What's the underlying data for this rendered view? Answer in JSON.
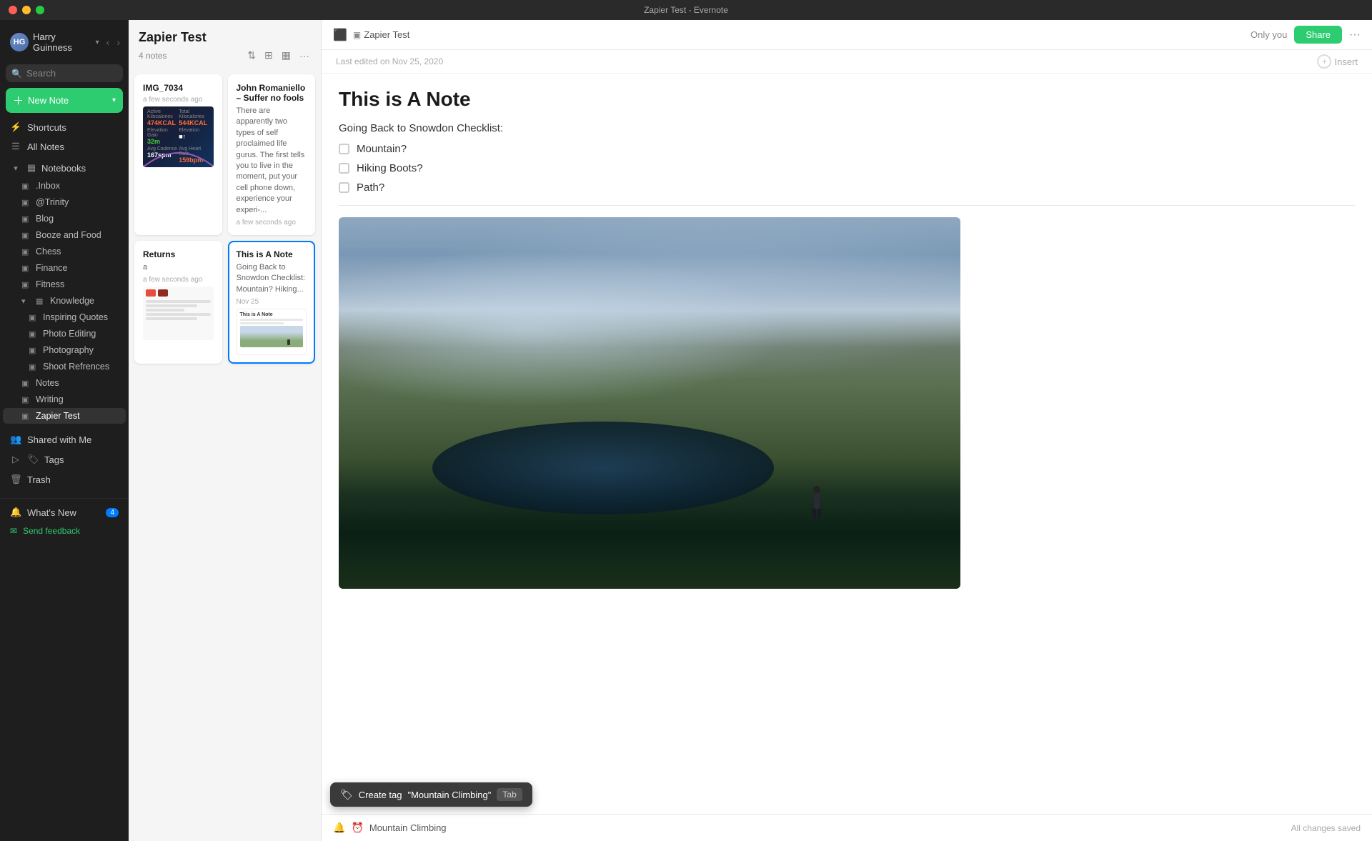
{
  "window": {
    "title": "Zapier Test - Evernote"
  },
  "sidebar": {
    "user_name": "Harry Guinness",
    "search_placeholder": "Search",
    "new_note_label": "New Note",
    "nav": [
      {
        "id": "shortcuts",
        "label": "Shortcuts",
        "icon": "⌂"
      },
      {
        "id": "all-notes",
        "label": "All Notes",
        "icon": "≡"
      },
      {
        "id": "notebooks",
        "label": "Notebooks",
        "icon": "▦",
        "expandable": true
      }
    ],
    "notebooks": [
      {
        "label": ".Inbox",
        "indent": 1
      },
      {
        "label": "@Trinity",
        "indent": 1
      },
      {
        "label": "Blog",
        "indent": 1
      },
      {
        "label": "Booze and Food",
        "indent": 1
      },
      {
        "label": "Chess",
        "indent": 1
      },
      {
        "label": "Finance",
        "indent": 1
      },
      {
        "label": "Fitness",
        "indent": 1
      },
      {
        "label": "Knowledge",
        "indent": 1,
        "expanded": true
      },
      {
        "label": "Inspiring Quotes",
        "indent": 2
      },
      {
        "label": "Photo Editing",
        "indent": 2
      },
      {
        "label": "Photography",
        "indent": 2
      },
      {
        "label": "Shoot Refrences",
        "indent": 2
      },
      {
        "label": "Notes",
        "indent": 1
      },
      {
        "label": "Writing",
        "indent": 1
      },
      {
        "label": "Zapier Test",
        "indent": 1,
        "active": true
      }
    ],
    "shared_with_me": "Shared with Me",
    "tags": "Tags",
    "trash": "Trash",
    "whats_new": "What's New",
    "whats_new_badge": "4",
    "feedback": "Send feedback"
  },
  "notes_list": {
    "title": "Zapier Test",
    "count": "4 notes",
    "notes": [
      {
        "id": "img7034",
        "title": "IMG_7034",
        "date": "a few seconds ago",
        "has_fitness_image": true
      },
      {
        "id": "john",
        "title": "John Romaniello – Suffer no fools",
        "preview": "There are apparently two types of self proclaimed life gurus. The first tells you to live in the moment, put your cell phone down, experience your experi-...",
        "date": "a few seconds ago"
      },
      {
        "id": "returns",
        "title": "Returns",
        "preview": "a",
        "date": "a few seconds ago",
        "has_doc_image": true
      },
      {
        "id": "this-is-a-note",
        "title": "This is A Note",
        "preview": "Going Back to Snowdon Checklist: Mountain? Hiking...",
        "date": "Nov 25",
        "selected": true,
        "has_mountain_preview": true
      }
    ]
  },
  "editor": {
    "notebook_name": "Zapier Test",
    "only_you": "Only you",
    "share_label": "Share",
    "last_edited": "Last edited on Nov 25, 2020",
    "insert_label": "Insert",
    "title": "This is A Note",
    "checklist_label": "Going Back to Snowdon Checklist:",
    "checklist_items": [
      {
        "label": "Mountain?",
        "checked": false
      },
      {
        "label": "Hiking Boots?",
        "checked": false
      },
      {
        "label": "Path?",
        "checked": false
      }
    ],
    "tag_suggestion_prefix": "Create tag ",
    "tag_name": "\"Mountain Climbing\"",
    "tag_shortcut": "Tab",
    "tag_input_value": "Mountain Climbing",
    "status": "All changes saved"
  }
}
